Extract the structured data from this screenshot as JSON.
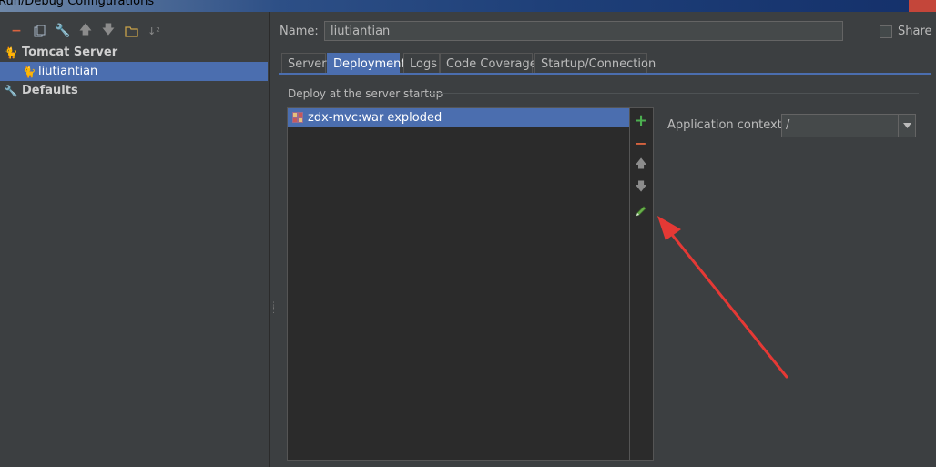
{
  "window": {
    "title": "Run/Debug Configurations"
  },
  "toolbar": {
    "icons": [
      "minus-icon",
      "copy-icon",
      "wrench-icon",
      "arrow-up-icon",
      "arrow-down-icon",
      "folder-icon",
      "sort-icon"
    ]
  },
  "tree": {
    "items": [
      {
        "label": "Tomcat Server",
        "bold": true
      },
      {
        "label": "liutiantian",
        "selected": true
      },
      {
        "label": "Defaults",
        "bold": true
      }
    ]
  },
  "name": {
    "label": "Name:",
    "value": "liutiantian"
  },
  "share": {
    "label": "Share",
    "checked": false
  },
  "tabs": [
    "Server",
    "Deployment",
    "Logs",
    "Code Coverage",
    "Startup/Connection"
  ],
  "active_tab": "Deployment",
  "deploy": {
    "section_title": "Deploy at the server startup",
    "artifacts": [
      "zdx-mvc:war exploded"
    ],
    "context_label": "Application context:",
    "context_value": "/"
  },
  "colors": {
    "selection": "#4b6eaf",
    "add_icon": "#4caf50",
    "remove_icon": "#d9633f",
    "arrow": "#e53935"
  }
}
